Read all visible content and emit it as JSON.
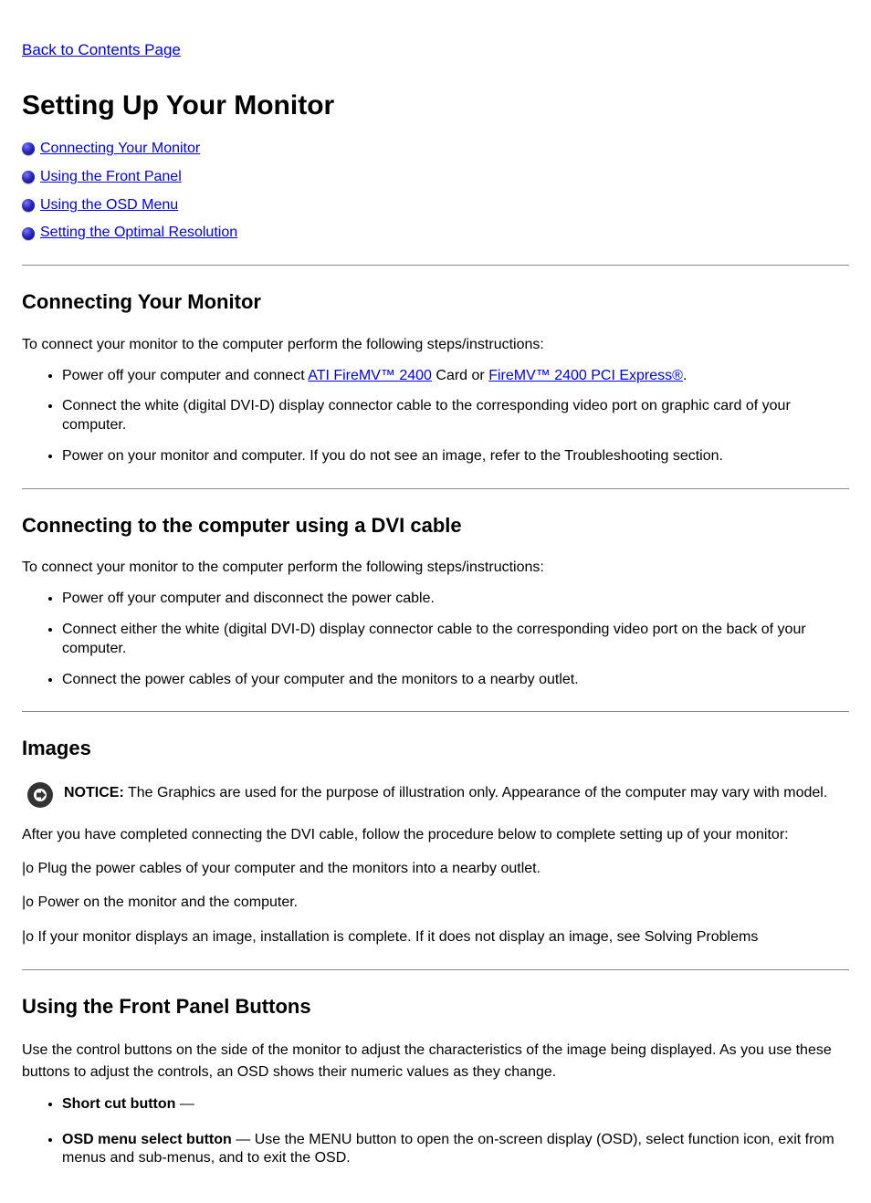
{
  "back_link": "Back to Contents Page",
  "title": "Setting Up Your Monitor",
  "toc": [
    {
      "label": "Connecting Your Monitor"
    },
    {
      "label": "Using the Front Panel"
    },
    {
      "label": "Using the OSD Menu"
    },
    {
      "label": "Setting the Optimal Resolution"
    }
  ],
  "section1": {
    "heading": "Connecting Your Monitor",
    "intro": "To connect your monitor to the computer perform the following steps/instructions:",
    "items": [
      {
        "prefix": "Power off your computer and connect",
        "link1": "ATI FireMV™ 2400",
        "mid": " Card or ",
        "link2": "FireMV™ 2400 PCI Express®",
        "suffix": "."
      },
      {
        "text": "Connect the white (digital DVI-D) display connector cable to the corresponding video port on graphic card of your computer."
      },
      {
        "text": "Power on your monitor and computer. If you do not see an image, refer to the Troubleshooting section."
      }
    ]
  },
  "section2": {
    "heading": "Connecting to the computer using a DVI cable",
    "intro": "To connect your monitor to the computer perform the following steps/instructions:",
    "items": [
      "Power off your computer and disconnect the power cable.",
      "Connect either the white (digital DVI-D) display connector cable to the corresponding video port on the back of your computer.",
      "Connect the power cables of your computer and the monitors to a nearby outlet."
    ]
  },
  "section3": {
    "heading": "Images",
    "notice_bold": "NOTICE:",
    "notice_text": " The Graphics are used for the purpose of illustration only. Appearance of the computer may vary with model.",
    "para1": "After you have completed connecting the DVI cable, follow the procedure below to complete setting up of your monitor:",
    "para2": "|o Plug the power cables of your computer and the monitors into a nearby outlet.",
    "para3": "|o Power on the monitor and the computer.",
    "para4": "|o If your monitor displays an image, installation is complete. If it does not display an image, see Solving Problems"
  },
  "section4": {
    "heading": "Using the Front Panel Buttons",
    "text": "Use the control buttons on the side of the monitor to adjust the characteristics of the image being displayed. As you use these buttons to adjust the controls, an OSD shows their numeric values as they change.",
    "items": [
      {
        "label": "Short cut button",
        "text": " — "
      },
      {
        "label": "OSD menu select button",
        "text": " — Use the MENU button to open the on-screen display (OSD), select function icon, exit from menus and sub-menus, and to exit the OSD."
      }
    ]
  }
}
